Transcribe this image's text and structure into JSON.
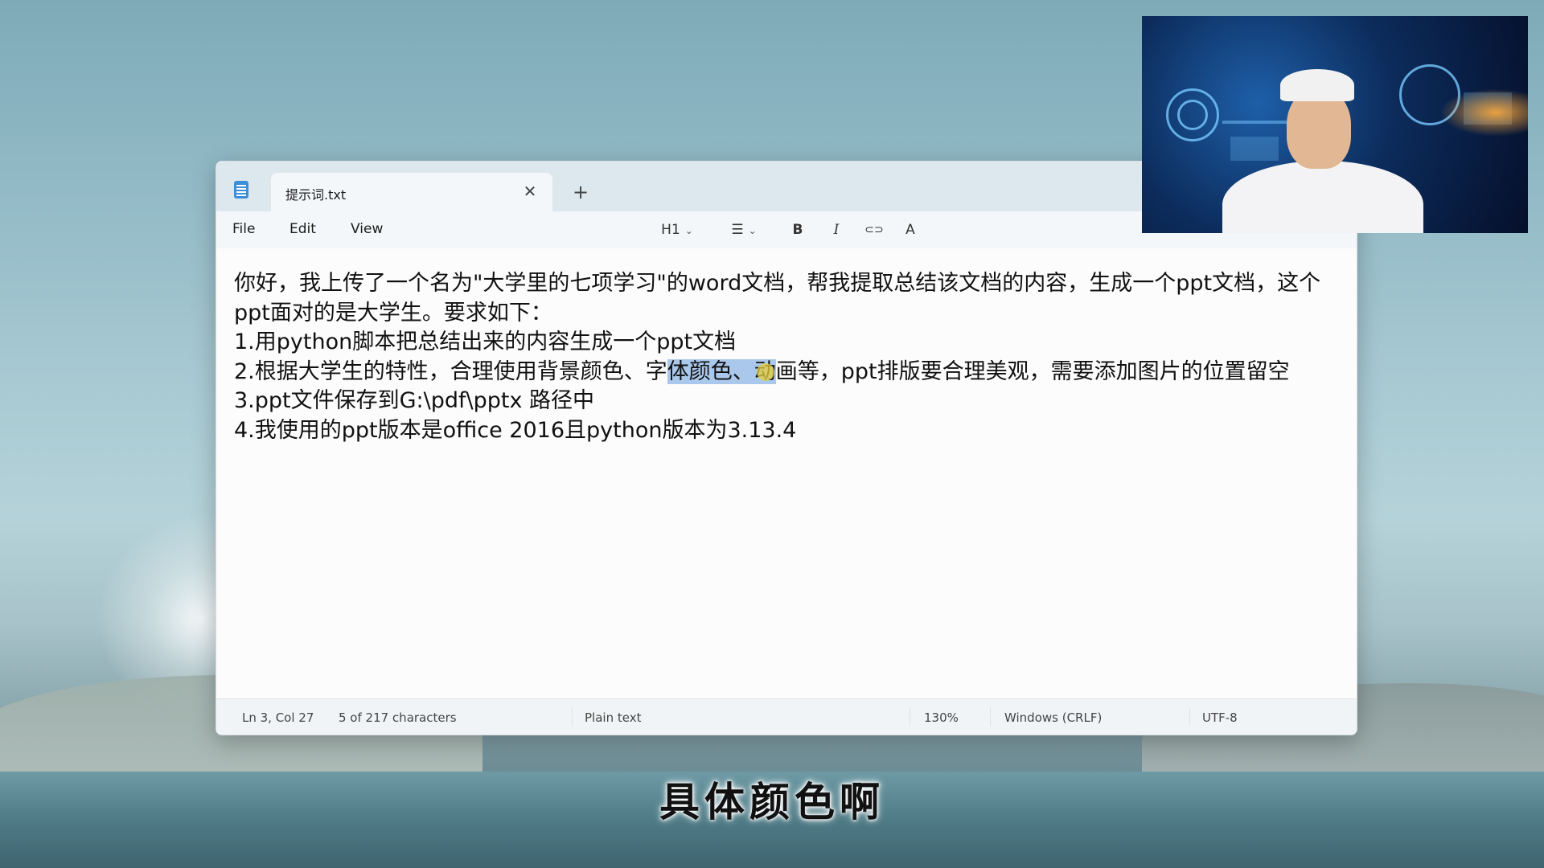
{
  "window": {
    "tab_title": "提示词.txt",
    "close_symbol": "✕",
    "new_tab_symbol": "+"
  },
  "menu": {
    "file": "File",
    "edit": "Edit",
    "view": "View"
  },
  "toolbar": {
    "heading": "H1",
    "chevron": "⌄",
    "list_icon": "☰",
    "bold": "B",
    "italic": "I",
    "link_icon": "⊂⊃",
    "spell_icon": "A"
  },
  "document": {
    "lines": [
      "你好，我上传了一个名为\"大学里的七项学习\"的word文档，帮我提取总结该文档的内容，生成一个ppt文档，这个",
      "ppt面对的是大学生。要求如下：",
      "1.用python脚本把总结出来的内容生成一个ppt文档",
      "3.ppt文件保存到G:\\pdf\\pptx 路径中",
      "4.我使用的ppt版本是office 2016且python版本为3.13.4"
    ],
    "line3_before": "2.根据大学生的特性，合理使用背景颜色、字",
    "line3_selected": "体颜色、动",
    "line3_after": "画等，ppt排版要合理美观，需要添加图片的位置留空"
  },
  "status": {
    "position": "Ln 3, Col 27",
    "selection": "5 of 217 characters",
    "format": "Plain text",
    "zoom": "130%",
    "line_ending": "Windows (CRLF)",
    "encoding": "UTF-8"
  },
  "subtitle": "具体颜色啊"
}
